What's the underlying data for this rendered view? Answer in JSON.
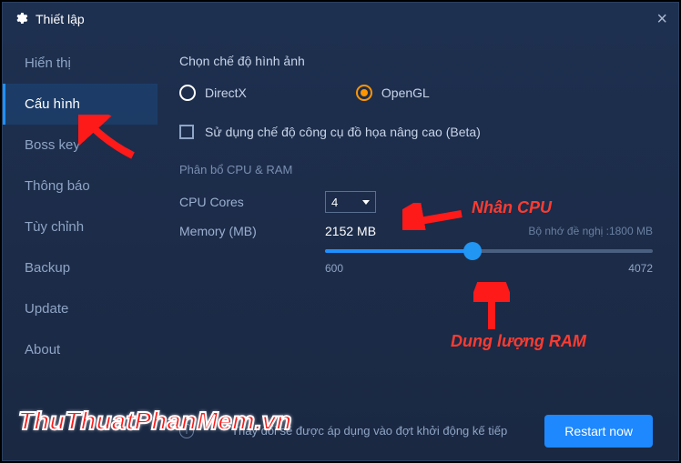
{
  "window": {
    "title": "Thiết lập"
  },
  "sidebar": {
    "items": [
      {
        "label": "Hiển thị"
      },
      {
        "label": "Cấu hình"
      },
      {
        "label": "Boss key"
      },
      {
        "label": "Thông báo"
      },
      {
        "label": "Tùy chỉnh"
      },
      {
        "label": "Backup"
      },
      {
        "label": "Update"
      },
      {
        "label": "About"
      }
    ],
    "active_index": 1
  },
  "graphics": {
    "title": "Chọn chế độ hình ảnh",
    "directx": "DirectX",
    "opengl": "OpenGL",
    "selected": "opengl",
    "advanced_label": "Sử dụng chế độ công cụ đồ họa nâng cao (Beta)"
  },
  "alloc": {
    "title": "Phân bổ CPU & RAM",
    "cpu_label": "CPU Cores",
    "cpu_value": "4",
    "mem_label": "Memory (MB)",
    "mem_value": "2152 MB",
    "recommend": "Bộ nhớ đề nghị :1800 MB",
    "slider_min": "600",
    "slider_max": "4072"
  },
  "footer": {
    "info": "Thay đổi sẽ được áp dụng vào đợt khởi động kế tiếp",
    "restart": "Restart now"
  },
  "annotations": {
    "cpu": "Nhân CPU",
    "ram": "Dung lượng RAM",
    "watermark": "ThuThuatPhanMem.vn"
  }
}
